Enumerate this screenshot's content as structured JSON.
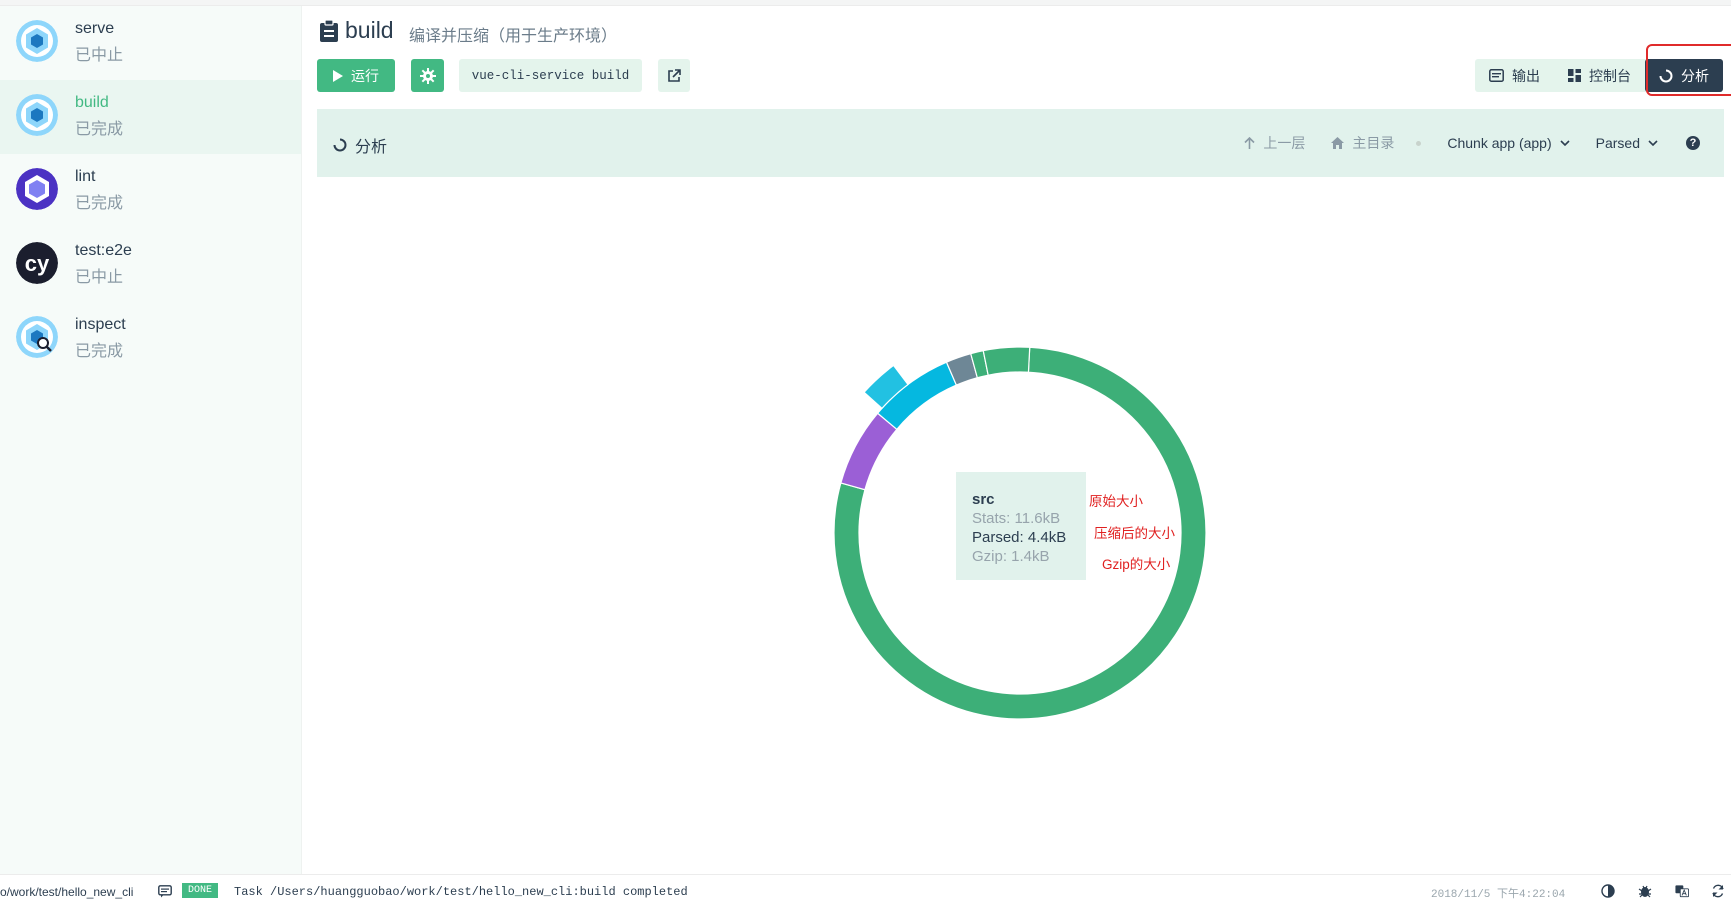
{
  "sidebar": {
    "tasks": [
      {
        "name": "serve",
        "status": "已中止"
      },
      {
        "name": "build",
        "status": "已完成"
      },
      {
        "name": "lint",
        "status": "已完成"
      },
      {
        "name": "test:e2e",
        "status": "已中止"
      },
      {
        "name": "inspect",
        "status": "已完成"
      }
    ],
    "cypress_logo_text": "cy"
  },
  "header": {
    "title": "build",
    "subtitle": "编译并压缩（用于生产环境）",
    "run_label": "运行",
    "command": "vue-cli-service build",
    "tabs": [
      {
        "label": "输出",
        "icon": "terminal-icon"
      },
      {
        "label": "控制台",
        "icon": "dashboard-icon"
      },
      {
        "label": "分析",
        "icon": "analyze-icon",
        "selected": true
      }
    ]
  },
  "toolbar": {
    "title": "分析",
    "up_label": "上一层",
    "home_label": "主目录",
    "chunk_select": "Chunk app (app)",
    "size_select": "Parsed"
  },
  "tooltip": {
    "name": "src",
    "stats": "Stats: 11.6kB",
    "parsed": "Parsed: 4.4kB",
    "gzip": "Gzip: 1.4kB"
  },
  "annotations": {
    "original": "原始大小",
    "compressed": "压缩后的大小",
    "gzip": "Gzip的大小"
  },
  "chart_data": {
    "type": "sunburst",
    "segments": [
      {
        "ring": "inner",
        "fraction": 0.785,
        "color": "#3daf78"
      },
      {
        "ring": "inner",
        "fraction": 0.068,
        "color": "#9b5fd6"
      },
      {
        "ring": "inner",
        "fraction": 0.074,
        "color": "#05b8e0"
      },
      {
        "ring": "inner",
        "fraction": 0.022,
        "color": "#6e8796"
      },
      {
        "ring": "inner",
        "fraction": 0.011,
        "color": "#3daf78"
      },
      {
        "ring": "inner",
        "fraction": 0.04,
        "color": "#3daf78"
      },
      {
        "ring": "outer",
        "fraction": 0.055,
        "color": "#22c1e2"
      }
    ]
  },
  "statusbar": {
    "path": "o/work/test/hello_new_cli",
    "done": "DONE",
    "log": "Task /Users/huangguobao/work/test/hello_new_cli:build completed",
    "time": "2018/11/5 下午4:22:04"
  },
  "colors": {
    "accent": "#42b983",
    "dark": "#2c3e50",
    "light_green": "#e1f2ec",
    "highlight_red": "#e02b2b"
  }
}
